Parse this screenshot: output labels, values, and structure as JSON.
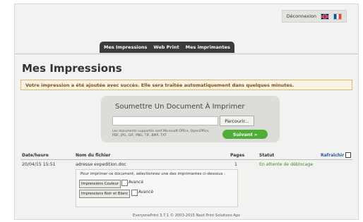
{
  "header": {
    "logout_label": "Déconnexion",
    "lang_flags": [
      "uk-flag-icon",
      "fr-flag-icon"
    ]
  },
  "nav": {
    "tabs": [
      "Mes Impressions",
      "Web Print",
      "Mes imprimantes"
    ]
  },
  "page_title": "Mes Impressions",
  "alert": "Votre impression a été ajoutée avec succès. Elle sera traitée automatiquement dans quelques minutes.",
  "upload": {
    "title": "Soumettre Un Document À Imprimer",
    "file_value": "",
    "browse_label": "Parcourir...",
    "hint": "Les documents supportés sont Microsoft Office, OpenOffice, PDF, JPG, GIF, PNG, TIF, BMP, TXT",
    "next_label": "Suivant »"
  },
  "table": {
    "headers": {
      "date": "Date/heure",
      "file": "Nom du fichier",
      "pages": "Pages",
      "status": "Statut",
      "refresh": "Rafraîchir"
    },
    "rows": [
      {
        "date": "20/04/15 15:51",
        "file": "adresse expedition.doc",
        "pages": "1",
        "status": "En attente de déblocage"
      }
    ]
  },
  "printers": {
    "instruction": "Pour imprimer ce document, sélectionnez une des imprimantes ci-dessous :",
    "options": [
      {
        "label": "Impressions Couleur",
        "advanced": "Avancé"
      },
      {
        "label": "Impressions Noir et Blanc",
        "advanced": "Avancé"
      }
    ]
  },
  "footer": "EveryonePrint 3.7.1 © 2003-2015 Next Print Solutions Aps",
  "colors": {
    "accent_green": "#4fae35",
    "status_green": "#3c8a2a",
    "alert_border": "#e2b46a",
    "nav_dark": "#3c3c3c"
  }
}
